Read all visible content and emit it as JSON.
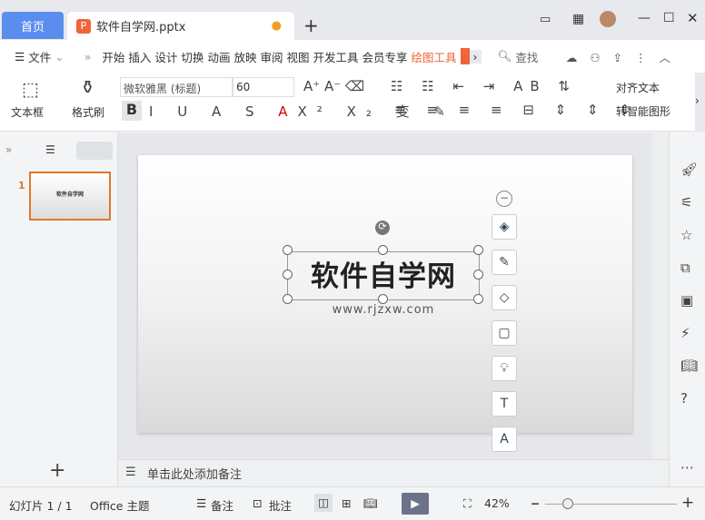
{
  "tabs": {
    "home": "首页",
    "doc": "软件自学网.pptx"
  },
  "menu": {
    "file": "文件",
    "items": [
      "开始",
      "插入",
      "设计",
      "切换",
      "动画",
      "放映",
      "审阅",
      "视图",
      "开发工具",
      "会员专享"
    ],
    "active": "绘图工具",
    "search": "查找"
  },
  "ribbon": {
    "textbox": "文本框",
    "format_painter": "格式刷",
    "font": "微软雅黑 (标题)",
    "size": "60",
    "align_text": "对齐文本",
    "smart_shape": "转智能图形"
  },
  "slide_panel": {
    "number": "1",
    "thumb_title": "软件自学网"
  },
  "slide": {
    "title": "软件自学网",
    "subtitle": "www.rjzxw.com"
  },
  "notes": {
    "placeholder": "单击此处添加备注"
  },
  "status": {
    "slide": "幻灯片 1 / 1",
    "theme": "Office 主题",
    "notes": "备注",
    "comment": "批注",
    "zoom": "42%"
  },
  "colors": {
    "accent": "#5b8def",
    "active_tab": "#f0643a"
  }
}
